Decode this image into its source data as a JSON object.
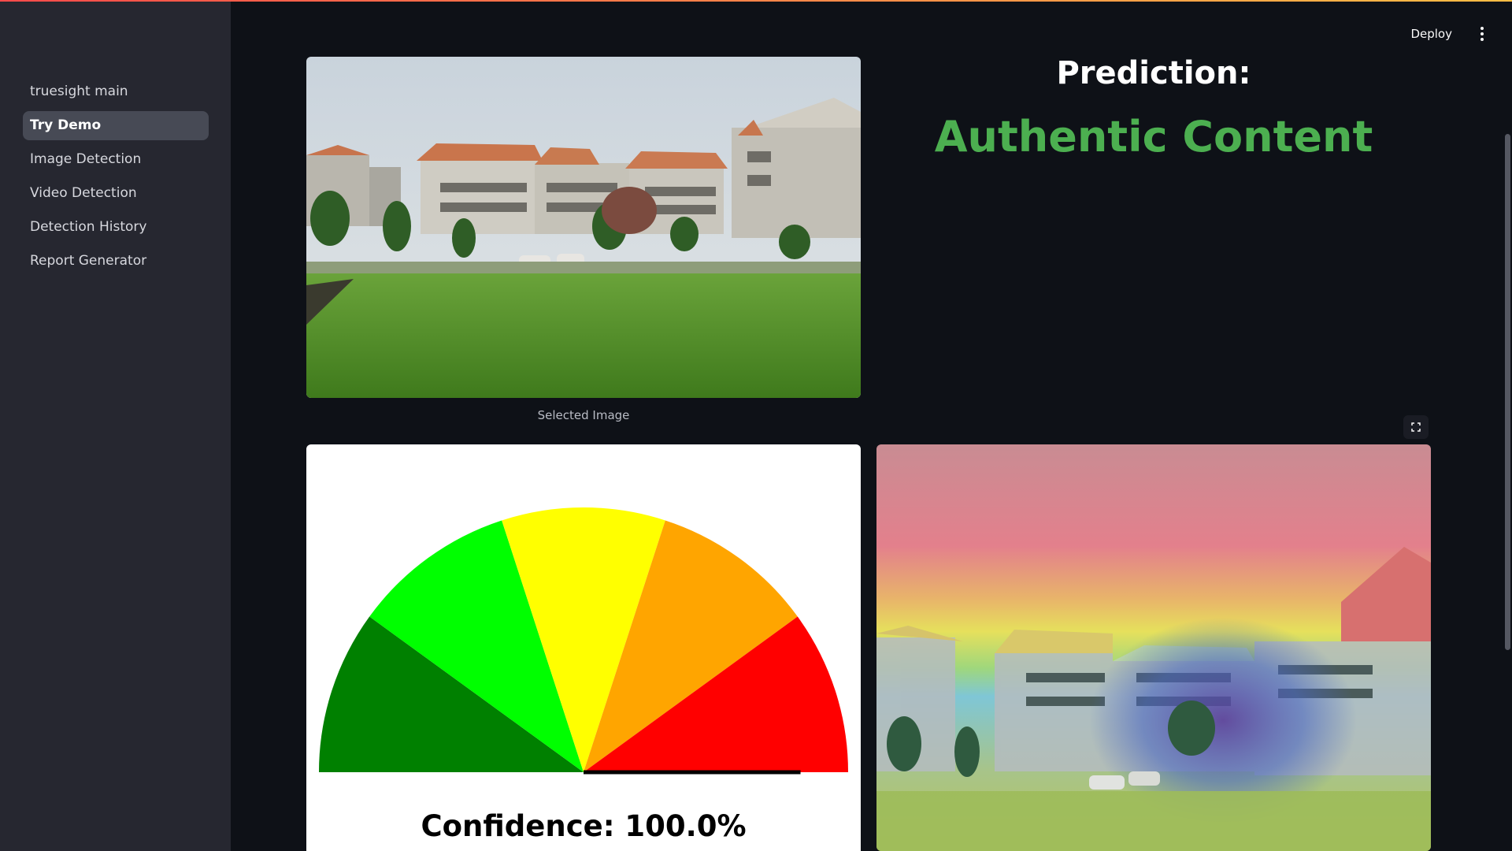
{
  "sidebar": {
    "items": [
      {
        "label": "truesight main",
        "active": false
      },
      {
        "label": "Try Demo",
        "active": true
      },
      {
        "label": "Image Detection",
        "active": false
      },
      {
        "label": "Video Detection",
        "active": false
      },
      {
        "label": "Detection History",
        "active": false
      },
      {
        "label": "Report Generator",
        "active": false
      }
    ]
  },
  "header": {
    "deploy_label": "Deploy"
  },
  "main": {
    "selected_image_caption": "Selected Image",
    "prediction_title": "Prediction:",
    "prediction_value": "Authentic Content",
    "prediction_color": "#4caf50",
    "gauge": {
      "label": "Confidence: 100.0%",
      "confidence_percent": 100.0,
      "segment_colors": [
        "#008000",
        "#00ff00",
        "#ffff00",
        "#ffa500",
        "#ff0000"
      ]
    }
  },
  "colors": {
    "background": "#0e1117",
    "sidebar": "#262730",
    "active_nav": "#474a55"
  },
  "icons": {
    "menu": "kebab-menu-icon",
    "fullscreen": "fullscreen-icon"
  }
}
